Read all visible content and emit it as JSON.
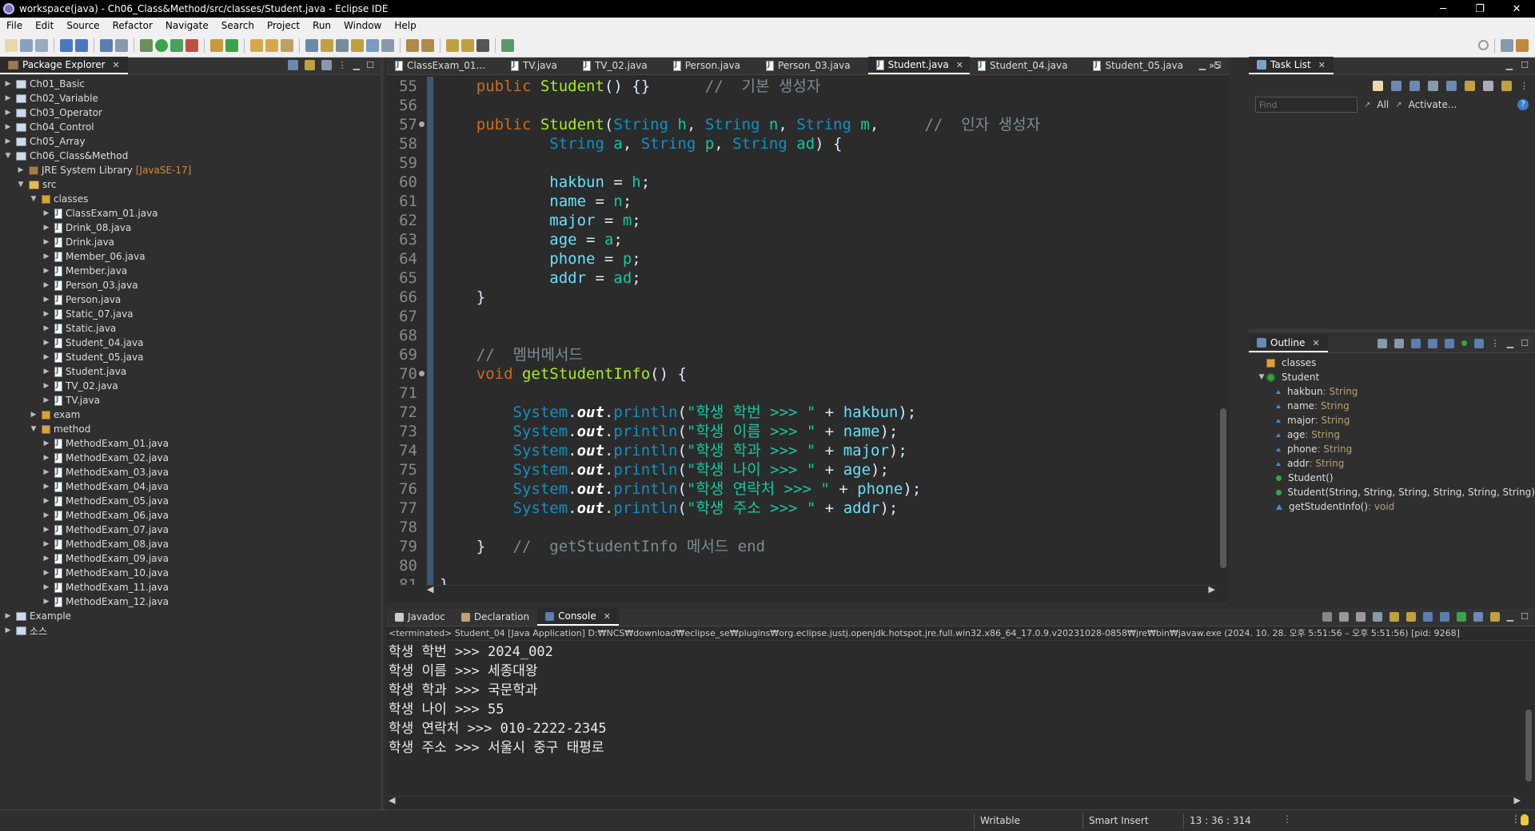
{
  "window": {
    "title": "workspace(java) - Ch06_Class&Method/src/classes/Student.java - Eclipse IDE",
    "minimize": "─",
    "restore": "❐",
    "close": "✕"
  },
  "menu": [
    "File",
    "Edit",
    "Source",
    "Refactor",
    "Navigate",
    "Search",
    "Project",
    "Run",
    "Window",
    "Help"
  ],
  "package_explorer": {
    "title": "Package Explorer",
    "items": [
      {
        "label": "Ch01_Basic",
        "depth": 0,
        "icon": "project",
        "open": false
      },
      {
        "label": "Ch02_Variable",
        "depth": 0,
        "icon": "project",
        "open": false
      },
      {
        "label": "Ch03_Operator",
        "depth": 0,
        "icon": "project",
        "open": false
      },
      {
        "label": "Ch04_Control",
        "depth": 0,
        "icon": "project",
        "open": false
      },
      {
        "label": "Ch05_Array",
        "depth": 0,
        "icon": "project",
        "open": false
      },
      {
        "label": "Ch06_Class&Method",
        "depth": 0,
        "icon": "project",
        "open": true
      },
      {
        "label": "JRE System Library",
        "decoration": "[JavaSE-17]",
        "depth": 1,
        "icon": "library",
        "open": false
      },
      {
        "label": "src",
        "depth": 1,
        "icon": "srcfolder",
        "open": true
      },
      {
        "label": "classes",
        "depth": 2,
        "icon": "package",
        "open": true
      },
      {
        "label": "ClassExam_01.java",
        "depth": 3,
        "icon": "java",
        "open": false
      },
      {
        "label": "Drink_08.java",
        "depth": 3,
        "icon": "java",
        "open": false
      },
      {
        "label": "Drink.java",
        "depth": 3,
        "icon": "java",
        "open": false
      },
      {
        "label": "Member_06.java",
        "depth": 3,
        "icon": "java",
        "open": false
      },
      {
        "label": "Member.java",
        "depth": 3,
        "icon": "java",
        "open": false
      },
      {
        "label": "Person_03.java",
        "depth": 3,
        "icon": "java",
        "open": false
      },
      {
        "label": "Person.java",
        "depth": 3,
        "icon": "java",
        "open": false
      },
      {
        "label": "Static_07.java",
        "depth": 3,
        "icon": "java",
        "open": false
      },
      {
        "label": "Static.java",
        "depth": 3,
        "icon": "java",
        "open": false
      },
      {
        "label": "Student_04.java",
        "depth": 3,
        "icon": "java",
        "open": false
      },
      {
        "label": "Student_05.java",
        "depth": 3,
        "icon": "java",
        "open": false
      },
      {
        "label": "Student.java",
        "depth": 3,
        "icon": "java",
        "open": false
      },
      {
        "label": "TV_02.java",
        "depth": 3,
        "icon": "java",
        "open": false
      },
      {
        "label": "TV.java",
        "depth": 3,
        "icon": "java",
        "open": false
      },
      {
        "label": "exam",
        "depth": 2,
        "icon": "package",
        "open": false
      },
      {
        "label": "method",
        "depth": 2,
        "icon": "package",
        "open": true
      },
      {
        "label": "MethodExam_01.java",
        "depth": 3,
        "icon": "java",
        "open": false
      },
      {
        "label": "MethodExam_02.java",
        "depth": 3,
        "icon": "java",
        "open": false
      },
      {
        "label": "MethodExam_03.java",
        "depth": 3,
        "icon": "java",
        "open": false
      },
      {
        "label": "MethodExam_04.java",
        "depth": 3,
        "icon": "java",
        "open": false
      },
      {
        "label": "MethodExam_05.java",
        "depth": 3,
        "icon": "java",
        "open": false
      },
      {
        "label": "MethodExam_06.java",
        "depth": 3,
        "icon": "java",
        "open": false
      },
      {
        "label": "MethodExam_07.java",
        "depth": 3,
        "icon": "java",
        "open": false
      },
      {
        "label": "MethodExam_08.java",
        "depth": 3,
        "icon": "java",
        "open": false
      },
      {
        "label": "MethodExam_09.java",
        "depth": 3,
        "icon": "java",
        "open": false
      },
      {
        "label": "MethodExam_10.java",
        "depth": 3,
        "icon": "java",
        "open": false
      },
      {
        "label": "MethodExam_11.java",
        "depth": 3,
        "icon": "java",
        "open": false
      },
      {
        "label": "MethodExam_12.java",
        "depth": 3,
        "icon": "java",
        "open": false
      },
      {
        "label": "Example",
        "depth": 0,
        "icon": "project",
        "open": false
      },
      {
        "label": "소스",
        "depth": 0,
        "icon": "project",
        "open": false
      }
    ]
  },
  "editor": {
    "tabs": [
      {
        "label": "ClassExam_01...",
        "active": false
      },
      {
        "label": "TV.java",
        "active": false
      },
      {
        "label": "TV_02.java",
        "active": false
      },
      {
        "label": "Person.java",
        "active": false
      },
      {
        "label": "Person_03.java",
        "active": false
      },
      {
        "label": "Student.java",
        "active": true
      },
      {
        "label": "Student_04.java",
        "active": false
      },
      {
        "label": "Student_05.java",
        "active": false
      }
    ],
    "overflow": "»5",
    "lines": [
      {
        "n": "55",
        "marker": false,
        "tokens": [
          [
            "pl",
            "    "
          ],
          [
            "kw",
            "public"
          ],
          [
            "pl",
            " "
          ],
          [
            "fn",
            "Student"
          ],
          [
            "pl",
            "() {}      "
          ],
          [
            "cm",
            "//  기본 생성자"
          ]
        ]
      },
      {
        "n": "56",
        "marker": false,
        "tokens": []
      },
      {
        "n": "57",
        "marker": true,
        "tokens": [
          [
            "pl",
            "    "
          ],
          [
            "kw",
            "public"
          ],
          [
            "pl",
            " "
          ],
          [
            "fn",
            "Student"
          ],
          [
            "pl",
            "("
          ],
          [
            "ty",
            "String"
          ],
          [
            "pl",
            " "
          ],
          [
            "st",
            "h"
          ],
          [
            "pl",
            ", "
          ],
          [
            "ty",
            "String"
          ],
          [
            "pl",
            " "
          ],
          [
            "st",
            "n"
          ],
          [
            "pl",
            ", "
          ],
          [
            "ty",
            "String"
          ],
          [
            "pl",
            " "
          ],
          [
            "st",
            "m"
          ],
          [
            "pl",
            ",     "
          ],
          [
            "cm",
            "//  인자 생성자"
          ]
        ]
      },
      {
        "n": "58",
        "marker": false,
        "tokens": [
          [
            "pl",
            "            "
          ],
          [
            "ty",
            "String"
          ],
          [
            "pl",
            " "
          ],
          [
            "st",
            "a"
          ],
          [
            "pl",
            ", "
          ],
          [
            "ty",
            "String"
          ],
          [
            "pl",
            " "
          ],
          [
            "st",
            "p"
          ],
          [
            "pl",
            ", "
          ],
          [
            "ty",
            "String"
          ],
          [
            "pl",
            " "
          ],
          [
            "st",
            "ad"
          ],
          [
            "pl",
            ") {"
          ]
        ]
      },
      {
        "n": "59",
        "marker": false,
        "tokens": []
      },
      {
        "n": "60",
        "marker": false,
        "tokens": [
          [
            "pl",
            "            "
          ],
          [
            "fld",
            "hakbun"
          ],
          [
            "pl",
            " = "
          ],
          [
            "st",
            "h"
          ],
          [
            "pl",
            ";"
          ]
        ]
      },
      {
        "n": "61",
        "marker": false,
        "tokens": [
          [
            "pl",
            "            "
          ],
          [
            "fld",
            "name"
          ],
          [
            "pl",
            " = "
          ],
          [
            "st",
            "n"
          ],
          [
            "pl",
            ";"
          ]
        ]
      },
      {
        "n": "62",
        "marker": false,
        "tokens": [
          [
            "pl",
            "            "
          ],
          [
            "fld",
            "major"
          ],
          [
            "pl",
            " = "
          ],
          [
            "st",
            "m"
          ],
          [
            "pl",
            ";"
          ]
        ]
      },
      {
        "n": "63",
        "marker": false,
        "tokens": [
          [
            "pl",
            "            "
          ],
          [
            "fld",
            "age"
          ],
          [
            "pl",
            " = "
          ],
          [
            "st",
            "a"
          ],
          [
            "pl",
            ";"
          ]
        ]
      },
      {
        "n": "64",
        "marker": false,
        "tokens": [
          [
            "pl",
            "            "
          ],
          [
            "fld",
            "phone"
          ],
          [
            "pl",
            " = "
          ],
          [
            "st",
            "p"
          ],
          [
            "pl",
            ";"
          ]
        ]
      },
      {
        "n": "65",
        "marker": false,
        "tokens": [
          [
            "pl",
            "            "
          ],
          [
            "fld",
            "addr"
          ],
          [
            "pl",
            " = "
          ],
          [
            "st",
            "ad"
          ],
          [
            "pl",
            ";"
          ]
        ]
      },
      {
        "n": "66",
        "marker": false,
        "tokens": [
          [
            "pl",
            "    }"
          ]
        ]
      },
      {
        "n": "67",
        "marker": false,
        "tokens": []
      },
      {
        "n": "68",
        "marker": false,
        "tokens": []
      },
      {
        "n": "69",
        "marker": false,
        "tokens": [
          [
            "pl",
            "    "
          ],
          [
            "cm",
            "//  멤버메서드"
          ]
        ]
      },
      {
        "n": "70",
        "marker": true,
        "tokens": [
          [
            "pl",
            "    "
          ],
          [
            "kw",
            "void"
          ],
          [
            "pl",
            " "
          ],
          [
            "mth",
            "getStudentInfo"
          ],
          [
            "pl",
            "() {"
          ]
        ]
      },
      {
        "n": "71",
        "marker": false,
        "tokens": []
      },
      {
        "n": "72",
        "marker": false,
        "tokens": [
          [
            "pl",
            "        "
          ],
          [
            "ty",
            "System"
          ],
          [
            "pl",
            "."
          ],
          [
            "ob",
            "out"
          ],
          [
            "pl",
            "."
          ],
          [
            "ty",
            "println"
          ],
          [
            "pl",
            "("
          ],
          [
            "st",
            "\"학생 학번 >>> \""
          ],
          [
            "pl",
            " + "
          ],
          [
            "fld",
            "hakbun"
          ],
          [
            "pl",
            ");"
          ]
        ]
      },
      {
        "n": "73",
        "marker": false,
        "tokens": [
          [
            "pl",
            "        "
          ],
          [
            "ty",
            "System"
          ],
          [
            "pl",
            "."
          ],
          [
            "ob",
            "out"
          ],
          [
            "pl",
            "."
          ],
          [
            "ty",
            "println"
          ],
          [
            "pl",
            "("
          ],
          [
            "st",
            "\"학생 이름 >>> \""
          ],
          [
            "pl",
            " + "
          ],
          [
            "fld",
            "name"
          ],
          [
            "pl",
            ");"
          ]
        ]
      },
      {
        "n": "74",
        "marker": false,
        "tokens": [
          [
            "pl",
            "        "
          ],
          [
            "ty",
            "System"
          ],
          [
            "pl",
            "."
          ],
          [
            "ob",
            "out"
          ],
          [
            "pl",
            "."
          ],
          [
            "ty",
            "println"
          ],
          [
            "pl",
            "("
          ],
          [
            "st",
            "\"학생 학과 >>> \""
          ],
          [
            "pl",
            " + "
          ],
          [
            "fld",
            "major"
          ],
          [
            "pl",
            ");"
          ]
        ]
      },
      {
        "n": "75",
        "marker": false,
        "tokens": [
          [
            "pl",
            "        "
          ],
          [
            "ty",
            "System"
          ],
          [
            "pl",
            "."
          ],
          [
            "ob",
            "out"
          ],
          [
            "pl",
            "."
          ],
          [
            "ty",
            "println"
          ],
          [
            "pl",
            "("
          ],
          [
            "st",
            "\"학생 나이 >>> \""
          ],
          [
            "pl",
            " + "
          ],
          [
            "fld",
            "age"
          ],
          [
            "pl",
            ");"
          ]
        ]
      },
      {
        "n": "76",
        "marker": false,
        "tokens": [
          [
            "pl",
            "        "
          ],
          [
            "ty",
            "System"
          ],
          [
            "pl",
            "."
          ],
          [
            "ob",
            "out"
          ],
          [
            "pl",
            "."
          ],
          [
            "ty",
            "println"
          ],
          [
            "pl",
            "("
          ],
          [
            "st",
            "\"학생 연락처 >>> \""
          ],
          [
            "pl",
            " + "
          ],
          [
            "fld",
            "phone"
          ],
          [
            "pl",
            ");"
          ]
        ]
      },
      {
        "n": "77",
        "marker": false,
        "tokens": [
          [
            "pl",
            "        "
          ],
          [
            "ty",
            "System"
          ],
          [
            "pl",
            "."
          ],
          [
            "ob",
            "out"
          ],
          [
            "pl",
            "."
          ],
          [
            "ty",
            "println"
          ],
          [
            "pl",
            "("
          ],
          [
            "st",
            "\"학생 주소 >>> \""
          ],
          [
            "pl",
            " + "
          ],
          [
            "fld",
            "addr"
          ],
          [
            "pl",
            ");"
          ]
        ]
      },
      {
        "n": "78",
        "marker": false,
        "tokens": []
      },
      {
        "n": "79",
        "marker": false,
        "tokens": [
          [
            "pl",
            "    }   "
          ],
          [
            "cm",
            "//  getStudentInfo 메서드 end"
          ]
        ]
      },
      {
        "n": "80",
        "marker": false,
        "tokens": []
      },
      {
        "n": "81",
        "marker": false,
        "tokens": [
          [
            "pl",
            "}"
          ]
        ]
      }
    ]
  },
  "task_list": {
    "title": "Task List",
    "find_placeholder": "Find",
    "all_label": "All",
    "activate_label": "Activate..."
  },
  "outline": {
    "title": "Outline",
    "items": [
      {
        "label": "classes",
        "type": "",
        "depth": 0,
        "kind": "package"
      },
      {
        "label": "Student",
        "type": "",
        "depth": 0,
        "kind": "class"
      },
      {
        "label": "hakbun",
        "type": " : String",
        "depth": 1,
        "kind": "field"
      },
      {
        "label": "name",
        "type": " : String",
        "depth": 1,
        "kind": "field"
      },
      {
        "label": "major",
        "type": " : String",
        "depth": 1,
        "kind": "field"
      },
      {
        "label": "age",
        "type": " : String",
        "depth": 1,
        "kind": "field"
      },
      {
        "label": "phone",
        "type": " : String",
        "depth": 1,
        "kind": "field"
      },
      {
        "label": "addr",
        "type": " : String",
        "depth": 1,
        "kind": "field"
      },
      {
        "label": "Student()",
        "type": "",
        "depth": 1,
        "kind": "ctor"
      },
      {
        "label": "Student(String, String, String, String, String, String)",
        "type": "",
        "depth": 1,
        "kind": "ctor"
      },
      {
        "label": "getStudentInfo()",
        "type": " : void",
        "depth": 1,
        "kind": "method"
      }
    ]
  },
  "bottom": {
    "tabs": [
      {
        "label": "Javadoc",
        "active": false
      },
      {
        "label": "Declaration",
        "active": false
      },
      {
        "label": "Console",
        "active": true
      }
    ],
    "terminated": "<terminated> Student_04 [Java Application] D:₩NCS₩download₩eclipse_se₩plugins₩org.eclipse.justj.openjdk.hotspot.jre.full.win32.x86_64_17.0.9.v20231028-0858₩jre₩bin₩javaw.exe  (2024. 10. 28. 오후 5:51:56 – 오후 5:51:56) [pid: 9268]",
    "output": [
      "학생 학번 >>> 2024_002",
      "학생 이름 >>> 세종대왕",
      "학생 학과 >>> 국문학과",
      "학생 나이 >>> 55",
      "학생 연락처 >>> 010-2222-2345",
      "학생 주소 >>> 서울시 중구 태평로"
    ]
  },
  "status": {
    "writable": "Writable",
    "insert_mode": "Smart Insert",
    "position": "13 : 36 : 314"
  }
}
